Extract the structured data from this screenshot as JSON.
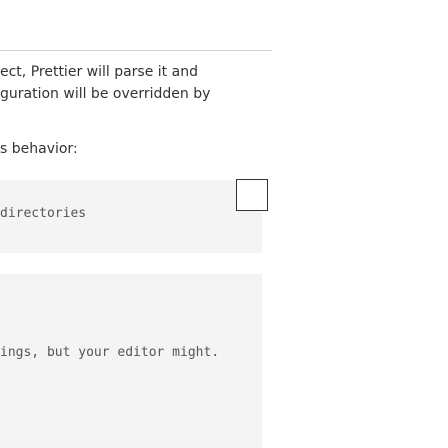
{
  "paragraphs": {
    "line1": "ect, Prettier will parse it and",
    "line2": "guration will be overridden by",
    "line3": "s behavior:"
  },
  "code_snippets": {
    "snippet1": "directories",
    "snippet2": "ings, but your editor might."
  }
}
